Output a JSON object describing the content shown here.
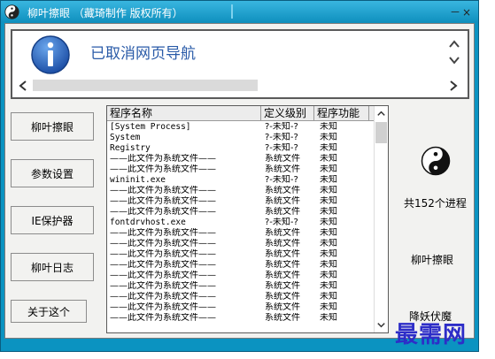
{
  "window": {
    "title": "柳叶擦眼 （藏琦制作 版权所有）",
    "controls": "－×"
  },
  "notification": {
    "text": "已取消网页导航"
  },
  "sidebar": {
    "items": [
      {
        "label": "柳叶擦眼"
      },
      {
        "label": "参数设置"
      },
      {
        "label": "IE保护器"
      },
      {
        "label": "柳叶日志"
      },
      {
        "label": "关于这个"
      }
    ]
  },
  "table": {
    "headers": [
      "程序名称",
      "定义级别",
      "程序功能"
    ],
    "rows": [
      [
        "[System Process]",
        "?-未知-?",
        "未知"
      ],
      [
        "System",
        "?-未知-?",
        "未知"
      ],
      [
        "Registry",
        "?-未知-?",
        "未知"
      ],
      [
        "——此文件为系统文件——",
        "系统文件",
        "未知"
      ],
      [
        "——此文件为系统文件——",
        "系统文件",
        "未知"
      ],
      [
        "wininit.exe",
        "?-未知-?",
        "未知"
      ],
      [
        "——此文件为系统文件——",
        "系统文件",
        "未知"
      ],
      [
        "——此文件为系统文件——",
        "系统文件",
        "未知"
      ],
      [
        "——此文件为系统文件——",
        "系统文件",
        "未知"
      ],
      [
        "fontdrvhost.exe",
        "?-未知-?",
        "未知"
      ],
      [
        "——此文件为系统文件——",
        "系统文件",
        "未知"
      ],
      [
        "——此文件为系统文件——",
        "系统文件",
        "未知"
      ],
      [
        "——此文件为系统文件——",
        "系统文件",
        "未知"
      ],
      [
        "——此文件为系统文件——",
        "系统文件",
        "未知"
      ],
      [
        "——此文件为系统文件——",
        "系统文件",
        "未知"
      ],
      [
        "——此文件为系统文件——",
        "系统文件",
        "未知"
      ],
      [
        "——此文件为系统文件——",
        "系统文件",
        "未知"
      ],
      [
        "——此文件为系统文件——",
        "系统文件",
        "未知"
      ],
      [
        "——此文件为系统文件——",
        "系统文件",
        "未知"
      ]
    ]
  },
  "right_panel": {
    "process_count": "共152个进程",
    "link1": "柳叶擦眼",
    "link2": "降妖伏魔"
  },
  "watermark": "最需网",
  "colors": {
    "frame": "#0b93c1",
    "notify_text": "#2a5ba8",
    "watermark": "#2d2dc8"
  }
}
